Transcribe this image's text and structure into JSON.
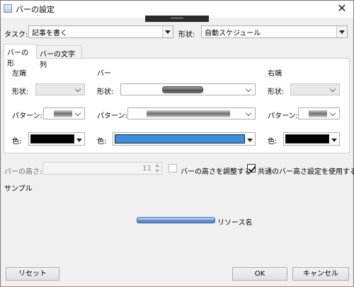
{
  "window": {
    "title": "バーの設定",
    "close_symbol": "✕"
  },
  "header": {
    "task_label": "タスク:",
    "task_value": "記事を書く",
    "shape_label": "形状:",
    "shape_value": "自動スケジュール"
  },
  "tabs": [
    {
      "label": "バーの形",
      "active": true
    },
    {
      "label": "バーの文字列",
      "active": false
    }
  ],
  "bar_shape": {
    "left_end_title": "左端",
    "bar_title": "バー",
    "right_end_title": "右端",
    "shape_label": "形状:",
    "pattern_label": "パターン:",
    "color_label": "色:",
    "left_end_color": "#000000",
    "bar_color": "#3c8ce0",
    "right_end_color": "#000000",
    "bar_shape_color": "#6e6e6e"
  },
  "bar_height": {
    "label": "バーの高さ:",
    "value": "11",
    "adjust_label": "バーの高さを調整する",
    "adjust_checked": false,
    "common_label": "共通のバー高さ設定を使用する",
    "common_checked": true
  },
  "sample": {
    "label": "サンプル",
    "resource_name": "リソース名",
    "bar_color": "#6e99d6"
  },
  "buttons": {
    "reset": "リセット",
    "ok": "OK",
    "cancel": "キャンセル"
  }
}
